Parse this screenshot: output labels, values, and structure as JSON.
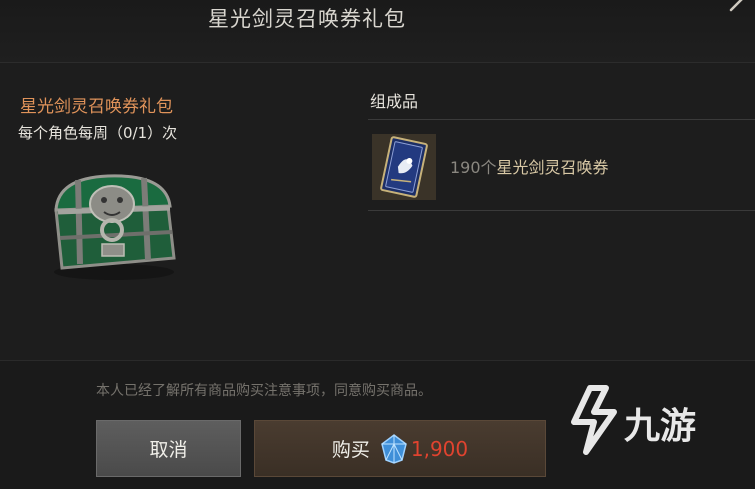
{
  "dialog": {
    "title": "星光剑灵召唤券礼包"
  },
  "item": {
    "name": "星光剑灵召唤券礼包",
    "purchase_limit": "每个角色每周（0/1）次",
    "icon": "treasure-chest-icon"
  },
  "components": {
    "heading": "组成品",
    "items": [
      {
        "quantity": "190个",
        "name": "星光剑灵召唤券",
        "icon": "summon-card-icon"
      }
    ]
  },
  "footer": {
    "notice": "本人已经了解所有商品购买注意事项，同意购买商品。",
    "cancel_label": "取消",
    "buy_label": "购买",
    "currency_icon": "blue-gem-icon",
    "price": "1,900",
    "price_color": "#e0432f"
  },
  "watermark": {
    "text": "九游",
    "icon": "9game-logo-icon"
  }
}
